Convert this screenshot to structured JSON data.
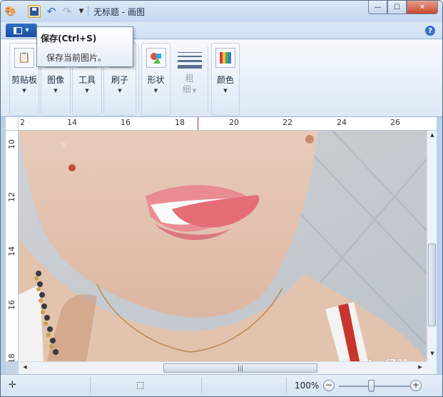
{
  "window": {
    "title": "无标题 - 画图",
    "minimize_glyph": "—",
    "maximize_glyph": "☐",
    "close_glyph": "✕"
  },
  "quick_access": {
    "icons": [
      "paint-app-icon",
      "save-icon",
      "undo-icon",
      "redo-icon",
      "customize-dropdown-icon"
    ]
  },
  "help_glyph": "?",
  "tooltip": {
    "title": "保存(Ctrl+S)",
    "description": "保存当前图片。"
  },
  "ribbon": {
    "groups": [
      {
        "label": "剪贴板",
        "icon": "clipboard-icon"
      },
      {
        "label": "图像",
        "icon": "image-icon"
      },
      {
        "label": "工具",
        "icon": "tools-icon"
      },
      {
        "label": "刷子",
        "icon": "brush-icon"
      },
      {
        "label": "形状",
        "icon": "shapes-icon"
      },
      {
        "label": "粗细",
        "label_line1": "粗",
        "label_line2": "细",
        "icon": "line-size-icon",
        "disabled": true
      },
      {
        "label": "颜色",
        "icon": "colors-icon"
      }
    ]
  },
  "ruler_h": {
    "labels": [
      "2",
      "14",
      "16",
      "18",
      "20",
      "22",
      "24",
      "26"
    ]
  },
  "ruler_v": {
    "labels": [
      "10",
      "12",
      "14",
      "16",
      "18"
    ]
  },
  "statusbar": {
    "zoom": "100%",
    "zoom_value_percent": 100,
    "icons": [
      "position-icon",
      "selection-size-icon"
    ]
  },
  "watermark": "Baidu 经验",
  "colors": {
    "title_bar": "#c4d8ef",
    "app_menu": "#1b4f9e",
    "close_button": "#c7462c",
    "ruler_cursor": "#d0251f"
  }
}
